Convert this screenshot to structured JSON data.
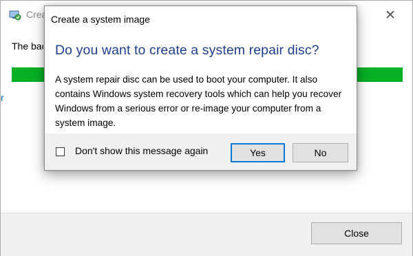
{
  "background_window": {
    "title": "Create a system image",
    "text": "The backup was saved successfully.",
    "progress_fraction": 1.0,
    "link_fragment": "r",
    "close_label": "Close",
    "close_glyph": "✕"
  },
  "dialog": {
    "title": "Create a system image",
    "heading": "Do you want to create a system repair disc?",
    "body": "A system repair disc can be used to boot your computer. It also contains Windows system recovery tools which can help you recover Windows from a serious error or re-image your computer from a system image.",
    "checkbox_label": "Don't show this message again",
    "checkbox_checked": false,
    "yes_label": "Yes",
    "no_label": "No"
  },
  "colors": {
    "heading": "#1e3f92",
    "progress": "#06b025",
    "default_button_border": "#0078d7"
  },
  "icons": {
    "app": "backup-restore-icon",
    "close": "close-icon"
  }
}
